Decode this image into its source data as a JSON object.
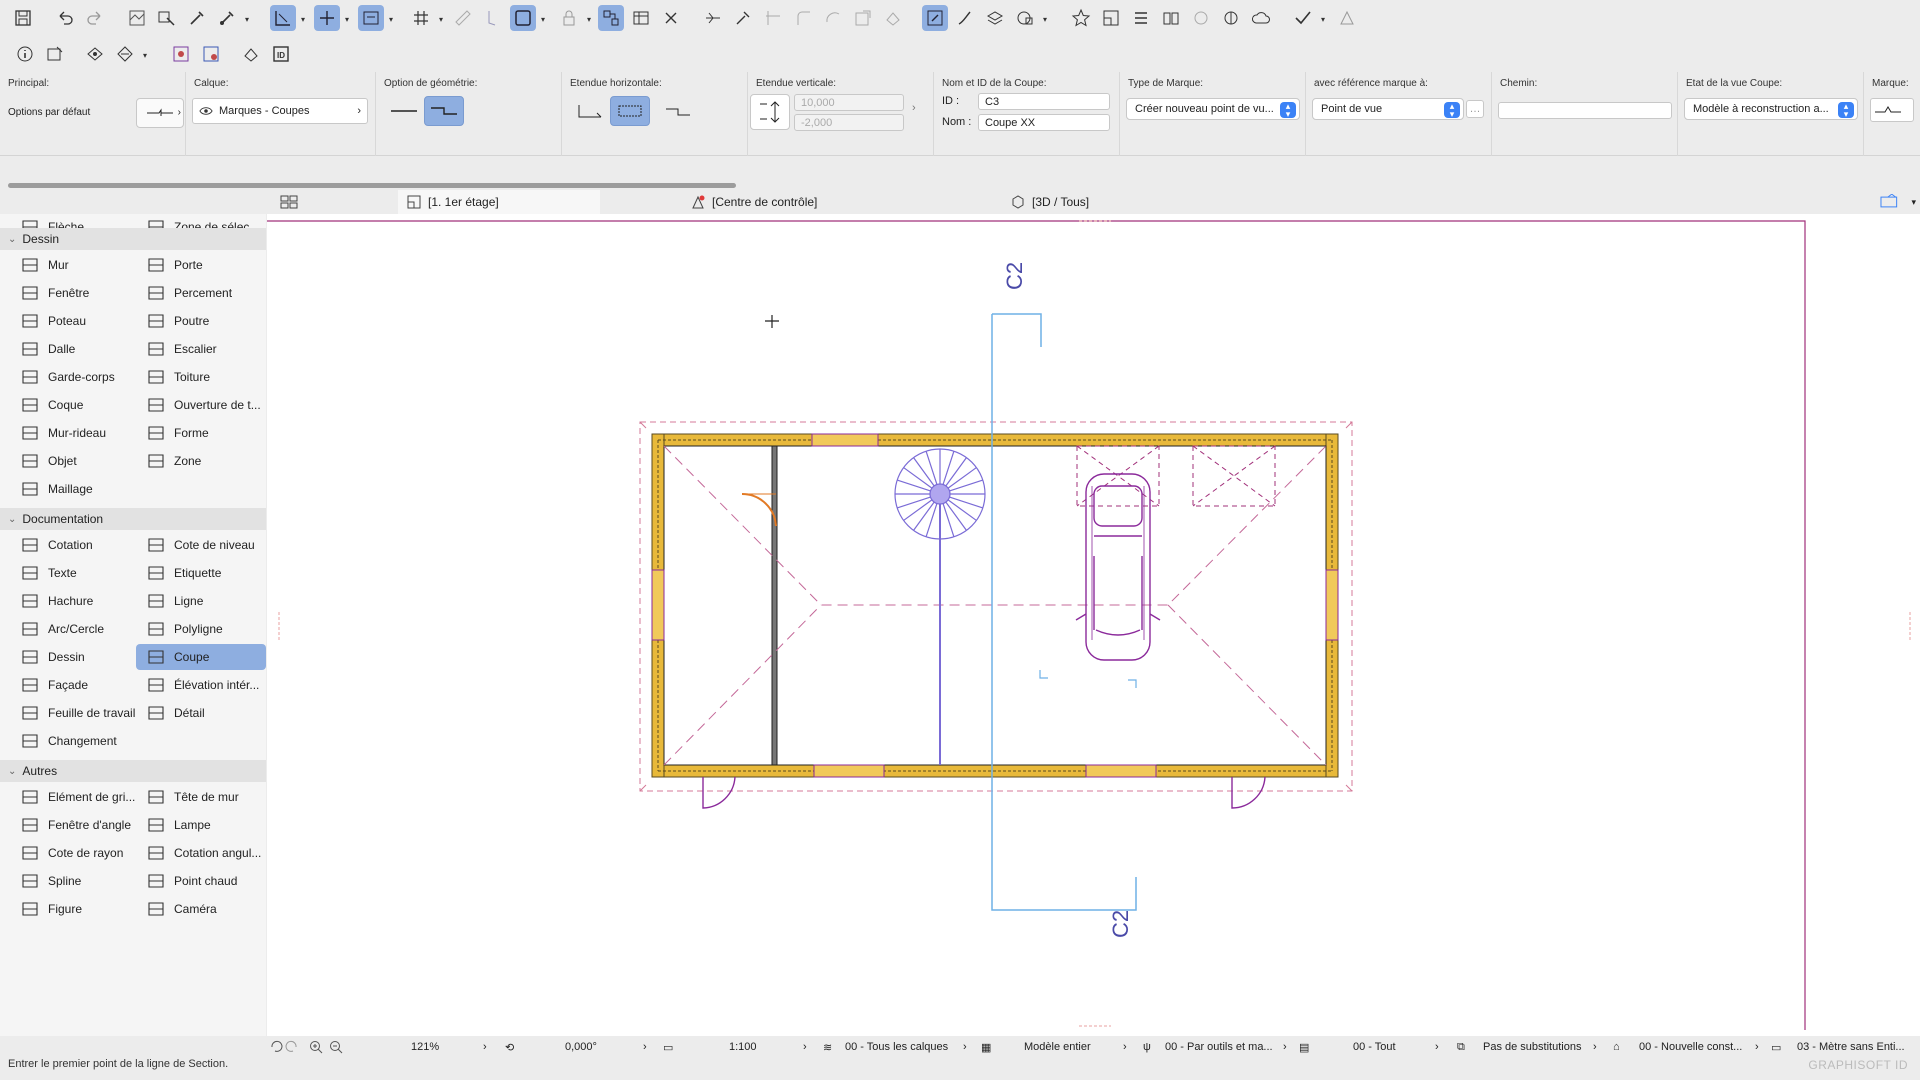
{
  "infobox": {
    "principal": {
      "label": "Principal:",
      "value": "Options par défaut"
    },
    "calque": {
      "label": "Calque:",
      "value": "Marques - Coupes"
    },
    "geometry": {
      "label": "Option de géométrie:"
    },
    "horizontal": {
      "label": "Etendue horizontale:"
    },
    "vertical": {
      "label": "Etendue verticale:",
      "top": "10,000",
      "bottom": "-2,000"
    },
    "name_id": {
      "label": "Nom et ID de la Coupe:",
      "id_label": "ID :",
      "id_value": "C3",
      "name_label": "Nom :",
      "name_value": "Coupe XX"
    },
    "marker_type": {
      "label": "Type de Marque:",
      "value": "Créer nouveau point de vu..."
    },
    "ref": {
      "label": "avec référence marque à:",
      "value": "Point de vue"
    },
    "path": {
      "label": "Chemin:",
      "value": ""
    },
    "view_state": {
      "label": "Etat de la vue Coupe:",
      "value": "Modèle à reconstruction a..."
    },
    "marker": {
      "label": "Marque:"
    }
  },
  "tabs": [
    {
      "label": "[1. 1er étage]"
    },
    {
      "label": "[Centre de contrôle]"
    },
    {
      "label": "[3D / Tous]"
    }
  ],
  "toolbox": {
    "top": [
      {
        "label": "Flèche"
      },
      {
        "label": "Zone de sélec..."
      }
    ],
    "groups": [
      {
        "title": "Dessin",
        "tools": [
          "Mur",
          "Porte",
          "Fenêtre",
          "Percement",
          "Poteau",
          "Poutre",
          "Dalle",
          "Escalier",
          "Garde-corps",
          "Toiture",
          "Coque",
          "Ouverture de t...",
          "Mur-rideau",
          "Forme",
          "Objet",
          "Zone",
          "Maillage"
        ]
      },
      {
        "title": "Documentation",
        "tools": [
          "Cotation",
          "Cote de niveau",
          "Texte",
          "Etiquette",
          "Hachure",
          "Ligne",
          "Arc/Cercle",
          "Polyligne",
          "Dessin",
          "Coupe",
          "Façade",
          "Élévation intér...",
          "Feuille de travail",
          "Détail",
          "Changement"
        ]
      },
      {
        "title": "Autres",
        "tools": [
          "Elément de gri...",
          "Tête de mur",
          "Fenêtre d'angle",
          "Lampe",
          "Cote de rayon",
          "Cotation angul...",
          "Spline",
          "Point chaud",
          "Figure",
          "Caméra"
        ]
      }
    ],
    "selected": "Coupe"
  },
  "canvas": {
    "section_marker_top": "C2",
    "section_marker_bottom": "C2"
  },
  "statusbar": {
    "zoom": "121%",
    "angle": "0,000°",
    "scale": "1:100",
    "layers": "00 - Tous les calques",
    "model": "Modèle entier",
    "pens": "00 - Par outils et ma...",
    "filter": "00 - Tout",
    "substitutions": "Pas de substitutions",
    "renovation": "00 - Nouvelle const...",
    "dimension": "03 - Mètre sans Enti...",
    "prompt": "Entrer le premier point de la ligne de Section.",
    "brand": "GRAPHISOFT ID"
  },
  "colors": {
    "accent": "#8eaee0",
    "wall_fill": "#e8b93a",
    "purple": "#8b2a9b",
    "section_line": "#6fb1e6",
    "stair": "#7a6bd6"
  }
}
